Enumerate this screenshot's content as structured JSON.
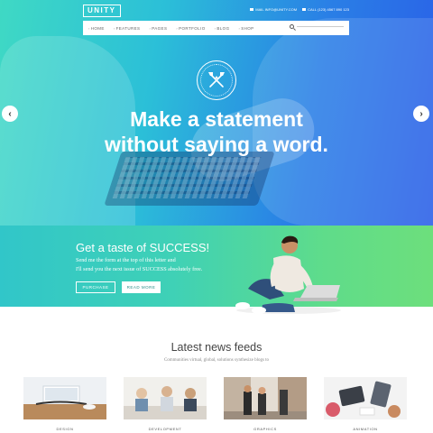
{
  "brand": {
    "logo": "UNITY"
  },
  "contact": {
    "email": "MAIL INFO@UNITY.COM",
    "phone": "CALL (123) 4567 890 123"
  },
  "nav": {
    "items": [
      "HOME",
      "FEATURES",
      "PAGES",
      "PORTFOLIO",
      "BLOG",
      "SHOP"
    ]
  },
  "hero": {
    "headline_line1": "Make a statement",
    "headline_line2": "without saying a word.",
    "gradient": [
      "#3fd9c4",
      "#2a5ee8"
    ]
  },
  "cta": {
    "title": "Get a taste of SUCCESS!",
    "line1": "Send me the form at the top of this letter and",
    "line2": "I'll send you the next issue of SUCCESS absolutely free.",
    "purchase_label": "PURCHASE",
    "readmore_label": "READ MORE",
    "gradient": [
      "#31c6c9",
      "#6ddf7c"
    ]
  },
  "news": {
    "title": "Latest news feeds",
    "subtitle": "Communities virtual, global, solutions synthesize blogs to",
    "cards": [
      {
        "label": "DESIGN"
      },
      {
        "label": "DEVELOPMENT"
      },
      {
        "label": "GRAPHICS"
      },
      {
        "label": "ANIMATION"
      }
    ]
  }
}
